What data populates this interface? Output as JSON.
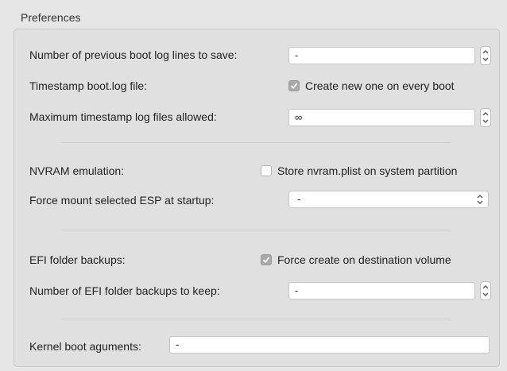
{
  "preferences": {
    "title": "Preferences",
    "boot_log_lines": {
      "label": "Number of previous boot log lines to save:",
      "value": "-"
    },
    "timestamp_boot_log": {
      "label": "Timestamp boot.log file:",
      "checkbox_label": "Create new one on every boot",
      "checked": true
    },
    "max_timestamp_logs": {
      "label": "Maximum timestamp log files allowed:",
      "value": "∞"
    },
    "nvram_emulation": {
      "label": "NVRAM emulation:",
      "checkbox_label": "Store nvram.plist on system partition",
      "checked": false
    },
    "force_mount_esp": {
      "label": "Force mount selected ESP at startup:",
      "selected": "-"
    },
    "efi_folder_backups": {
      "label": "EFI folder backups:",
      "checkbox_label": "Force create on destination volume",
      "checked": true
    },
    "efi_backups_to_keep": {
      "label": "Number of EFI folder backups to keep:",
      "value": "-"
    },
    "kernel_boot_args": {
      "label": "Kernel boot aguments:",
      "value": "-"
    }
  },
  "icons": {
    "stepper": "up-down-stepper-icon",
    "select_chevron": "up-down-chevron-icon",
    "checkmark": "checkmark-icon"
  },
  "colors": {
    "background": "#e6e6e6",
    "checkbox_checked": "#a9a9a9"
  }
}
